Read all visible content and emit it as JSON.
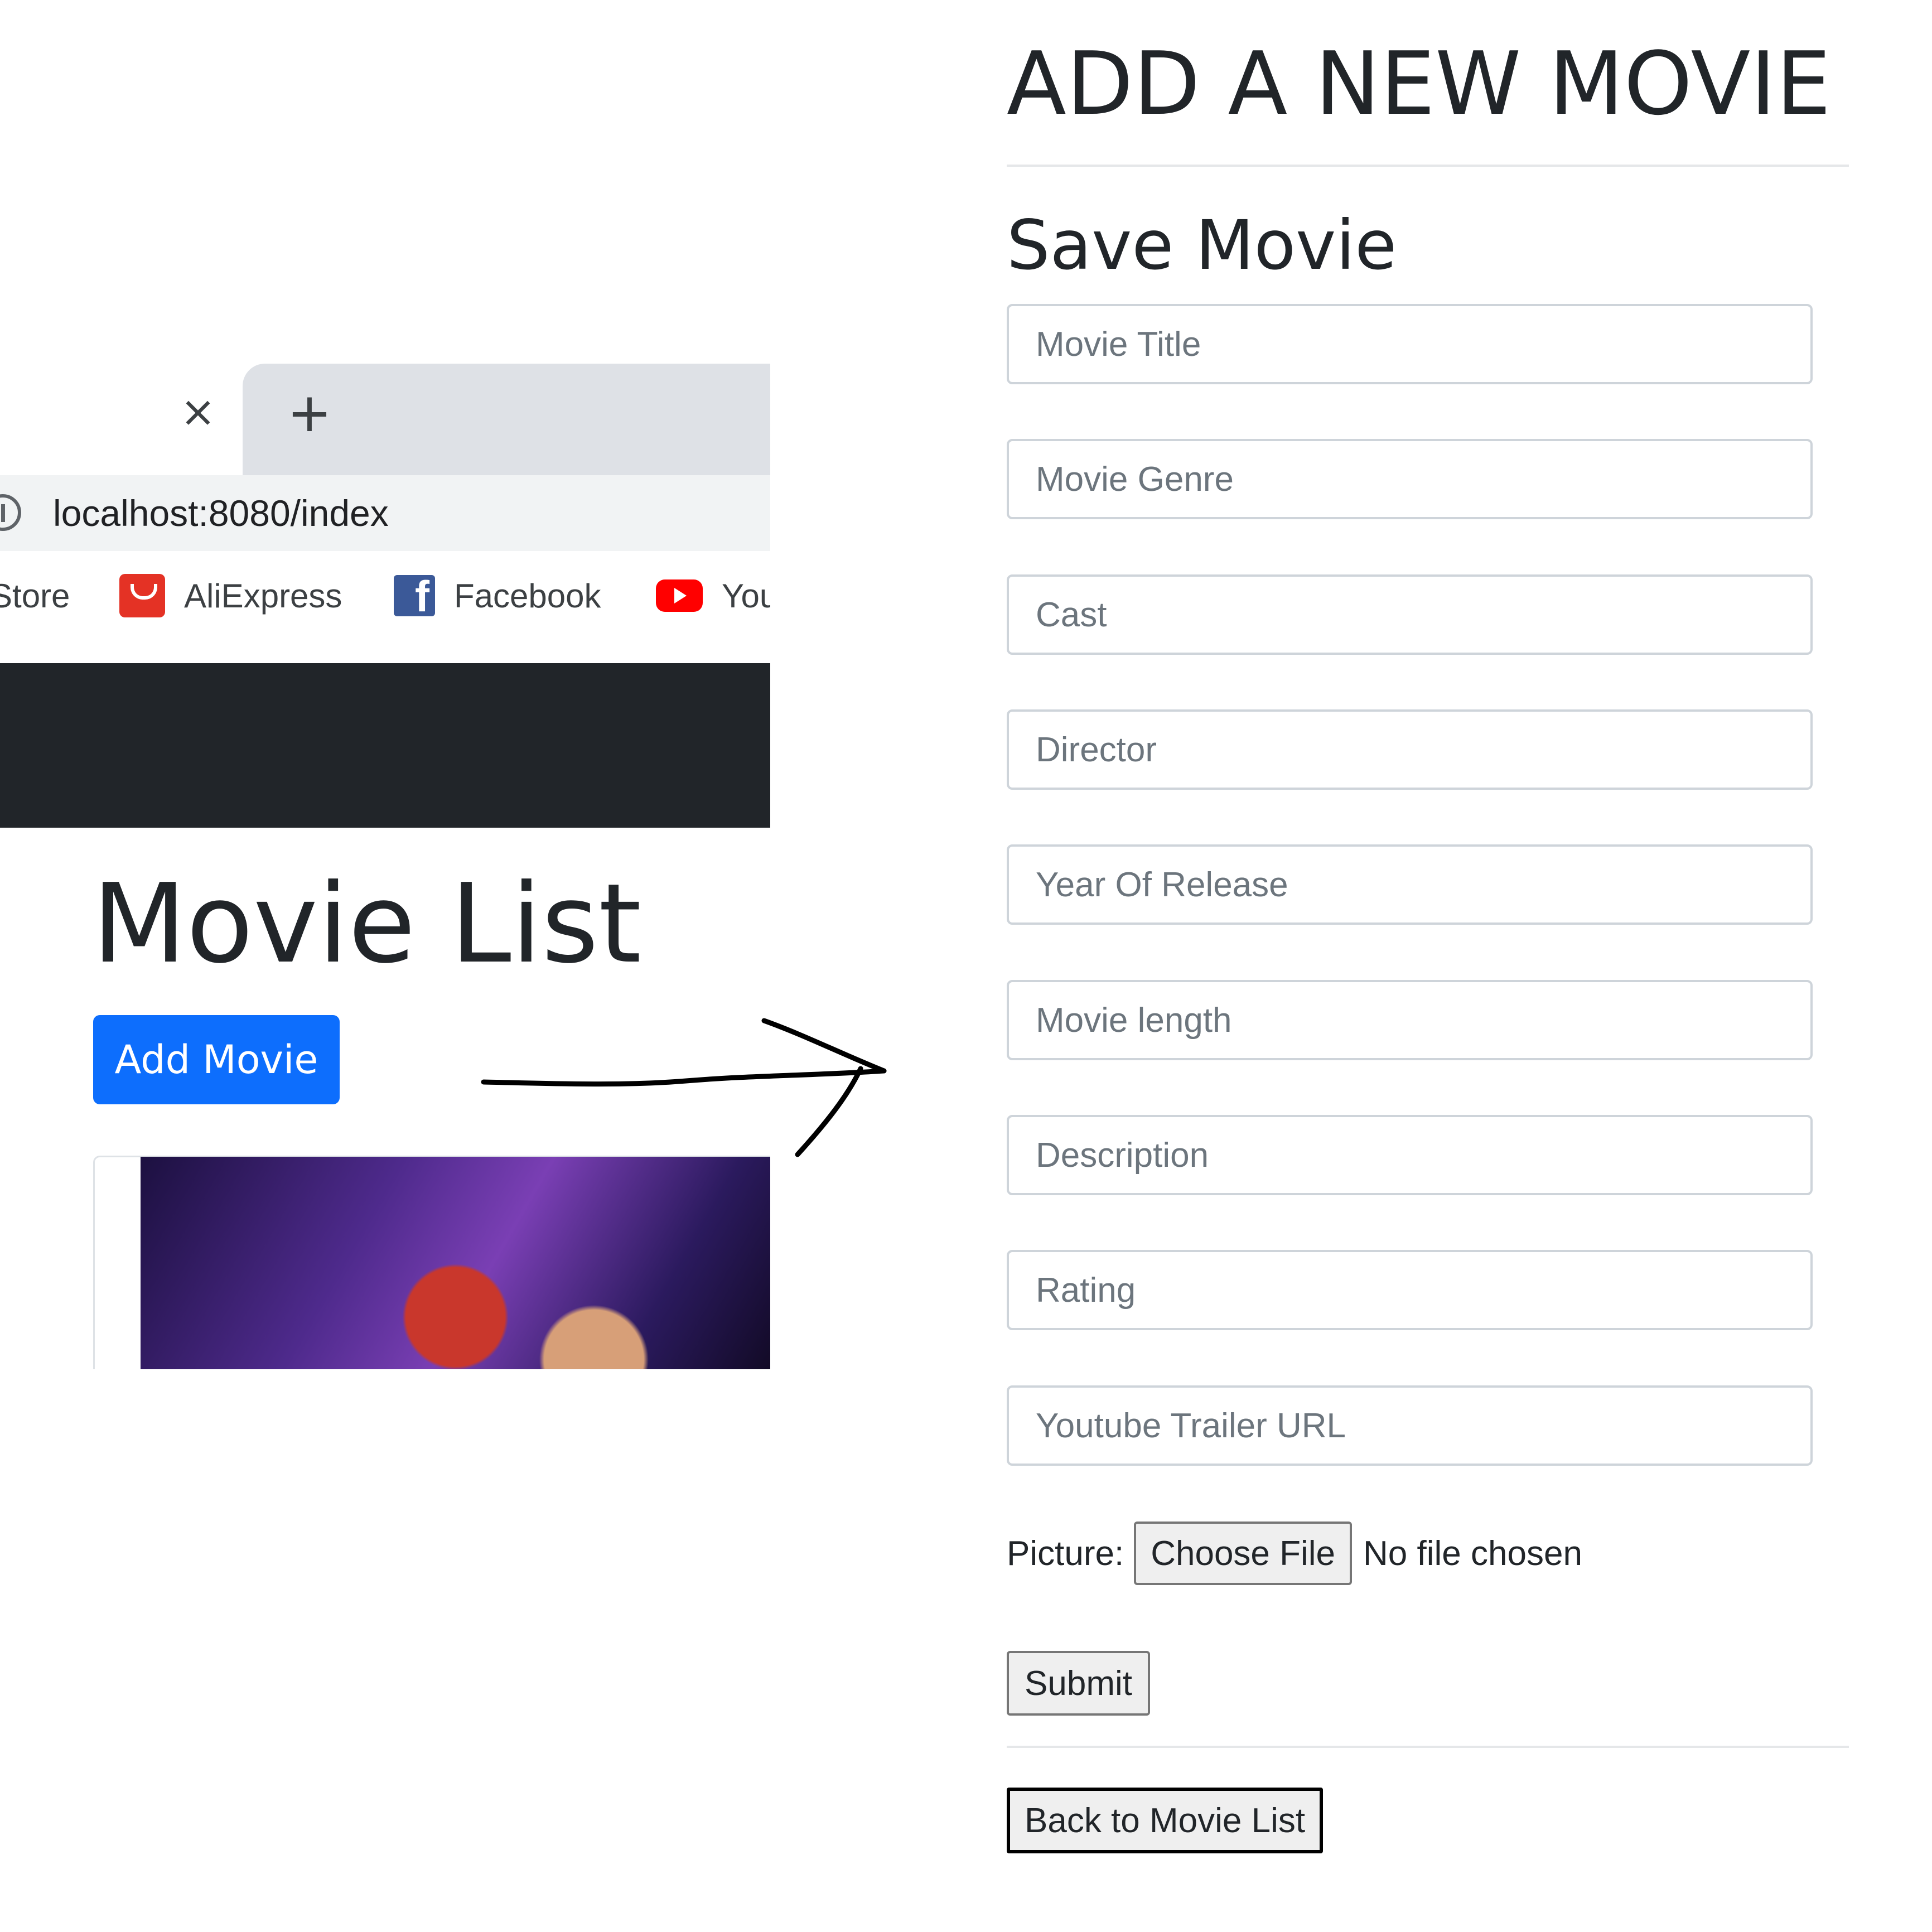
{
  "browser": {
    "tab_close_glyph": "×",
    "new_tab_glyph": "+",
    "url": "localhost:8080/index",
    "bookmarks": [
      {
        "label": "Store",
        "icon": "none"
      },
      {
        "label": "AliExpress",
        "icon": "aliexpress-icon"
      },
      {
        "label": "Facebook",
        "icon": "facebook-icon"
      },
      {
        "label": "You",
        "icon": "youtube-icon"
      }
    ]
  },
  "index_page": {
    "title": "Movie List",
    "add_button_label": "Add Movie",
    "poster": "movie-poster-image"
  },
  "form_page": {
    "heading": "ADD A NEW MOVIE",
    "form_title": "Save Movie",
    "fields": [
      {
        "placeholder": "Movie Title",
        "value": ""
      },
      {
        "placeholder": "Movie Genre",
        "value": ""
      },
      {
        "placeholder": "Cast",
        "value": ""
      },
      {
        "placeholder": "Director",
        "value": ""
      },
      {
        "placeholder": "Year Of Release",
        "value": ""
      },
      {
        "placeholder": "Movie length",
        "value": ""
      },
      {
        "placeholder": "Description",
        "value": ""
      },
      {
        "placeholder": "Rating",
        "value": ""
      },
      {
        "placeholder": "Youtube Trailer URL",
        "value": ""
      }
    ],
    "picture_label": "Picture:",
    "choose_file_label": "Choose File",
    "file_status": "No file chosen",
    "submit_label": "Submit",
    "back_label": "Back to Movie List"
  },
  "colors": {
    "primary_button": "#0d6efd",
    "navbar": "#212529",
    "tab_strip": "#dee1e6"
  }
}
